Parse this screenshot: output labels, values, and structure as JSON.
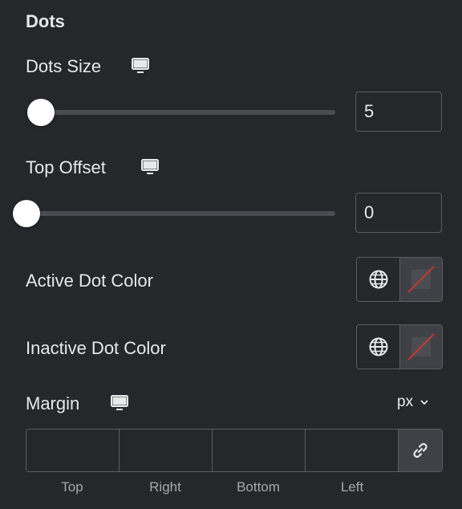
{
  "section": {
    "title": "Dots"
  },
  "dots_size": {
    "label": "Dots Size",
    "device_icon": "desktop-icon",
    "value": "5",
    "slider_fraction": 0.0
  },
  "top_offset": {
    "label": "Top Offset",
    "device_icon": "desktop-icon",
    "value": "0",
    "slider_fraction": 0.0
  },
  "active_dot_color": {
    "label": "Active Dot Color",
    "global_icon": "globe-icon",
    "swatch_state": "no-color"
  },
  "inactive_dot_color": {
    "label": "Inactive Dot Color",
    "global_icon": "globe-icon",
    "swatch_state": "no-color"
  },
  "margin": {
    "label": "Margin",
    "device_icon": "desktop-icon",
    "unit": "px",
    "unit_icon": "chevron-down-icon",
    "link_icon": "link-icon",
    "fields": [
      {
        "label": "Top",
        "value": ""
      },
      {
        "label": "Right",
        "value": ""
      },
      {
        "label": "Bottom",
        "value": ""
      },
      {
        "label": "Left",
        "value": ""
      }
    ]
  },
  "colors": {
    "background": "#26272b",
    "text": "#e6e8ea",
    "muted_text": "#a4a7ac",
    "border": "#5a5c62",
    "track": "#4a4c52",
    "thumb": "#ffffff",
    "swatch_bg": "#3f4147",
    "no_color_slash": "#c0392b"
  }
}
